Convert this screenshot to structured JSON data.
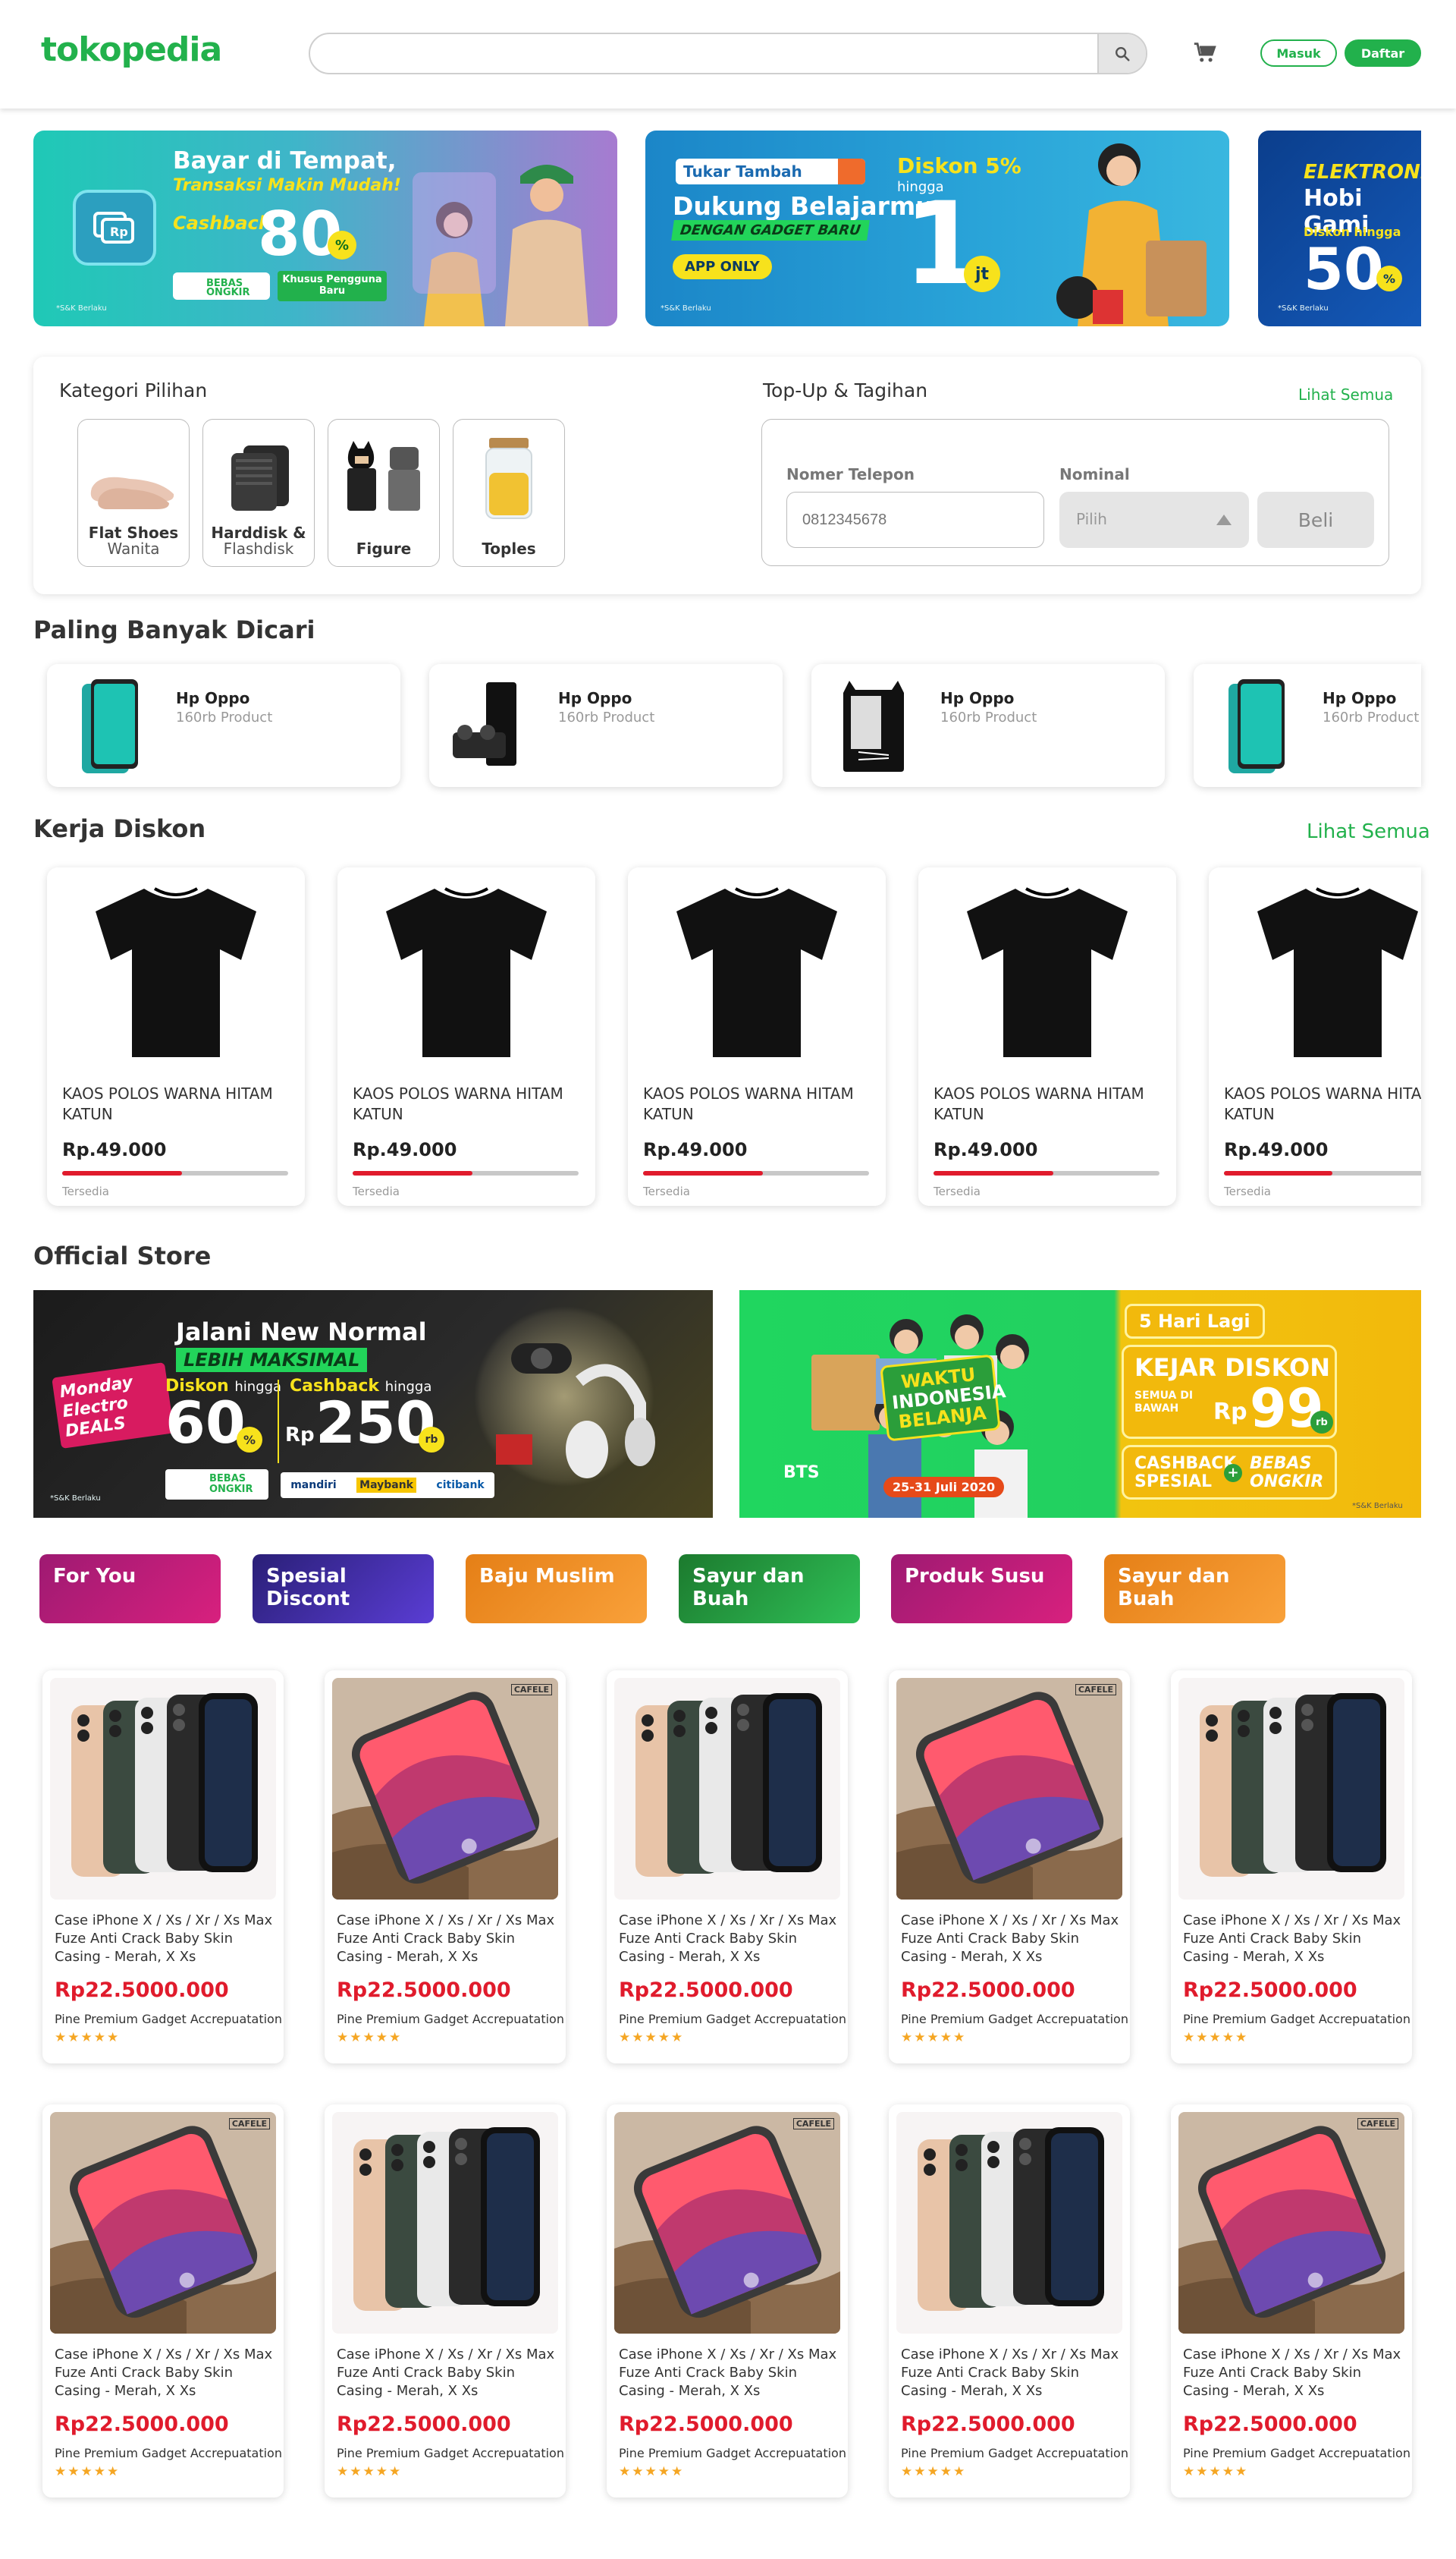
{
  "header": {
    "logo": "tokopedia",
    "search_placeholder": "",
    "login_label": "Masuk",
    "register_label": "Daftar"
  },
  "banners": [
    {
      "line1": "Bayar di Tempat,",
      "line2": "Transaksi Makin Mudah!",
      "cashback_label": "Cashback",
      "cashback_value": "80",
      "badge1": "BEBAS ONGKIR",
      "badge2": "Khusus Pengguna Baru",
      "note": "*S&K Berlaku"
    },
    {
      "tag": "Tukar Tambah",
      "line1": "Dukung Belajarmu",
      "line2": "DENGAN GADGET BARU",
      "app_only": "APP ONLY",
      "discount_label": "Diskon 5%",
      "upto": "hingga",
      "value": "1",
      "unit": "jt",
      "note": "*S&K Berlaku"
    },
    {
      "line1": "ELEKTRONI",
      "line2": "Hobi Gami",
      "discount_label": "Diskon hingga",
      "value": "50",
      "note": "*S&K Berlaku"
    }
  ],
  "kategori": {
    "title": "Kategori Pilihan",
    "items": [
      {
        "label": "Flat Shoes",
        "sub": "Wanita"
      },
      {
        "label": "Harddisk &",
        "sub": "Flashdisk"
      },
      {
        "label": "Figure",
        "sub": ""
      },
      {
        "label": "Toples",
        "sub": ""
      }
    ]
  },
  "topup": {
    "title": "Top-Up & Tagihan",
    "see_all": "Lihat Semua",
    "phone_label": "Nomer Telepon",
    "phone_placeholder": "0812345678",
    "nominal_label": "Nominal",
    "nominal_placeholder": "Pilih",
    "buy_label": "Beli"
  },
  "popular": {
    "title": "Paling Banyak Dicari",
    "items": [
      {
        "name": "Hp Oppo",
        "count": "160rb Product"
      },
      {
        "name": "Hp Oppo",
        "count": "160rb Product"
      },
      {
        "name": "Hp Oppo",
        "count": "160rb Product"
      },
      {
        "name": "Hp Oppo",
        "count": "160rb Product"
      }
    ]
  },
  "diskon": {
    "title": "Kerja Diskon",
    "see_all": "Lihat Semua",
    "items": [
      {
        "name": "KAOS POLOS WARNA HITAM KATUN",
        "price": "Rp.49.000",
        "stock_label": "Tersedia",
        "progress": 0.53
      },
      {
        "name": "KAOS POLOS WARNA HITAM KATUN",
        "price": "Rp.49.000",
        "stock_label": "Tersedia",
        "progress": 0.53
      },
      {
        "name": "KAOS POLOS WARNA HITAM KATUN",
        "price": "Rp.49.000",
        "stock_label": "Tersedia",
        "progress": 0.53
      },
      {
        "name": "KAOS POLOS WARNA HITAM KATUN",
        "price": "Rp.49.000",
        "stock_label": "Tersedia",
        "progress": 0.53
      },
      {
        "name": "KAOS POLOS WARNA HITAM KATUN",
        "price": "Rp.49.000",
        "stock_label": "Tersedia",
        "progress": 0.53
      }
    ]
  },
  "official": {
    "title": "Official Store",
    "banner1": {
      "badge": "Monday Electro DEALS",
      "line1": "Jalani New Normal",
      "line2": "LEBIH MAKSIMAL",
      "diskon": "Diskon",
      "hingga": "hingga",
      "diskon_value": "60",
      "cashback": "Cashback",
      "cashback_value": "250",
      "rp": "Rp",
      "rb": "rb",
      "ongkir": "BEBAS ONGKIR",
      "bank1": "mandiri",
      "bank2": "Maybank",
      "bank3": "citibank",
      "note": "*S&K Berlaku"
    },
    "banner2": {
      "line1": "WAKTU",
      "line2": "INDONESIA",
      "line3": "BELANJA",
      "dates": "25-31 Juli 2020",
      "bts": "BTS",
      "days_left": "5 Hari Lagi",
      "kejar": "KEJAR DISKON",
      "semua": "SEMUA DI BAWAH",
      "rp": "Rp",
      "value": "99",
      "rb": "rb",
      "cashback": "CASHBACK SPESIAL",
      "plus": "+",
      "ongkir": "BEBAS ONGKIR",
      "note": "*S&K Berlaku"
    }
  },
  "tabs": [
    {
      "label": "For You"
    },
    {
      "label": "Spesial Discont"
    },
    {
      "label": "Baju Muslim"
    },
    {
      "label": "Sayur dan Buah"
    },
    {
      "label": "Produk Susu"
    },
    {
      "label": "Sayur dan Buah"
    }
  ],
  "products": [
    {
      "image": "iphone-11-pro",
      "name": "Case iPhone X / Xs / Xr / Xs Max Fuze Anti Crack Baby Skin Casing - Merah, X Xs",
      "price": "Rp22.5000.000",
      "store": "Pine Premium Gadget Accrepuatation",
      "rating": 5
    },
    {
      "image": "iphone-x",
      "brand": "CAFELE",
      "name": "Case iPhone X / Xs / Xr / Xs Max Fuze Anti Crack Baby Skin Casing - Merah, X Xs",
      "price": "Rp22.5000.000",
      "store": "Pine Premium Gadget Accrepuatation",
      "rating": 5
    },
    {
      "image": "iphone-11-pro",
      "name": "Case iPhone X / Xs / Xr / Xs Max Fuze Anti Crack Baby Skin Casing - Merah, X Xs",
      "price": "Rp22.5000.000",
      "store": "Pine Premium Gadget Accrepuatation",
      "rating": 5
    },
    {
      "image": "iphone-x",
      "brand": "CAFELE",
      "name": "Case iPhone X / Xs / Xr / Xs Max Fuze Anti Crack Baby Skin Casing - Merah, X Xs",
      "price": "Rp22.5000.000",
      "store": "Pine Premium Gadget Accrepuatation",
      "rating": 5
    },
    {
      "image": "iphone-11-pro",
      "name": "Case iPhone X / Xs / Xr / Xs Max Fuze Anti Crack Baby Skin Casing - Merah, X Xs",
      "price": "Rp22.5000.000",
      "store": "Pine Premium Gadget Accrepuatation",
      "rating": 5
    },
    {
      "image": "iphone-x",
      "brand": "CAFELE",
      "name": "Case iPhone X / Xs / Xr / Xs Max Fuze Anti Crack Baby Skin Casing - Merah, X Xs",
      "price": "Rp22.5000.000",
      "store": "Pine Premium Gadget Accrepuatation",
      "rating": 5
    },
    {
      "image": "iphone-11-pro",
      "name": "Case iPhone X / Xs / Xr / Xs Max Fuze Anti Crack Baby Skin Casing - Merah, X Xs",
      "price": "Rp22.5000.000",
      "store": "Pine Premium Gadget Accrepuatation",
      "rating": 5
    },
    {
      "image": "iphone-x",
      "brand": "CAFELE",
      "name": "Case iPhone X / Xs / Xr / Xs Max Fuze Anti Crack Baby Skin Casing - Merah, X Xs",
      "price": "Rp22.5000.000",
      "store": "Pine Premium Gadget Accrepuatation",
      "rating": 5
    },
    {
      "image": "iphone-11-pro",
      "name": "Case iPhone X / Xs / Xr / Xs Max Fuze Anti Crack Baby Skin Casing - Merah, X Xs",
      "price": "Rp22.5000.000",
      "store": "Pine Premium Gadget Accrepuatation",
      "rating": 5
    },
    {
      "image": "iphone-x",
      "brand": "CAFELE",
      "name": "Case iPhone X / Xs / Xr / Xs Max Fuze Anti Crack Baby Skin Casing - Merah, X Xs",
      "price": "Rp22.5000.000",
      "store": "Pine Premium Gadget Accrepuatation",
      "rating": 5
    }
  ],
  "colors": {
    "brand_green": "#22b14c",
    "price_red": "#e01b2c",
    "star": "#f5a623",
    "tab_for_you": "#c2186f",
    "tab_spesial": "#3a2a99",
    "tab_baju": "#ef8a1b",
    "tab_sayur": "#23a33a",
    "tab_susu": "#b51a7e",
    "tab_sayur2": "#ef8a1b"
  }
}
